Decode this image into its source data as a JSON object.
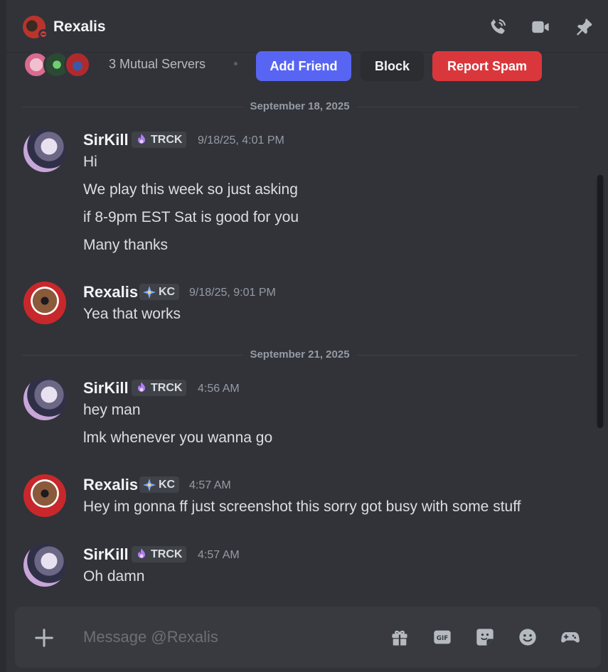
{
  "header": {
    "title": "Rexalis",
    "icons": [
      "call-icon",
      "video-icon",
      "pin-icon"
    ]
  },
  "mutual": {
    "text": "3 Mutual Servers",
    "add_friend": "Add Friend",
    "block": "Block",
    "report_spam": "Report Spam"
  },
  "colors": {
    "blurple": "#5865f2",
    "danger": "#da373c",
    "background": "#323339"
  },
  "messages": [
    {
      "date": "September 18, 2025"
    },
    {
      "author": "SirKill",
      "tag": "TRCK",
      "time": "9/18/25, 4:01 PM",
      "lines": [
        "Hi",
        "We play this week so just asking",
        "if 8-9pm EST Sat is good for you",
        "Many thanks"
      ]
    },
    {
      "author": "Rexalis",
      "tag": "KC",
      "time": "9/18/25, 9:01 PM",
      "lines": [
        "Yea that works"
      ]
    },
    {
      "date": "September 21, 2025"
    },
    {
      "author": "SirKill",
      "tag": "TRCK",
      "time": "4:56 AM",
      "lines": [
        "hey man",
        "lmk whenever you wanna go"
      ]
    },
    {
      "author": "Rexalis",
      "tag": "KC",
      "time": "4:57 AM",
      "lines": [
        "Hey im gonna ff just screenshot this sorry got busy with some stuff"
      ]
    },
    {
      "author": "SirKill",
      "tag": "TRCK",
      "time": "4:57 AM",
      "lines": [
        "Oh damn"
      ]
    }
  ],
  "composer": {
    "placeholder": "Message @Rexalis",
    "icons": [
      "gift-icon",
      "gif-icon",
      "sticker-icon",
      "emoji-icon",
      "apps-icon"
    ]
  }
}
